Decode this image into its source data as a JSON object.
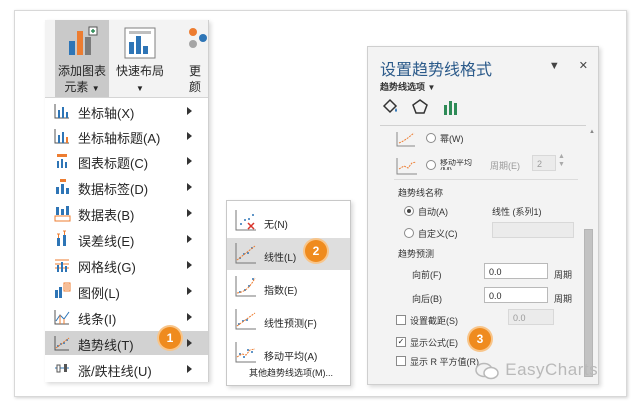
{
  "ribbon": {
    "add_element_line1": "添加图表",
    "add_element_line2": "元素",
    "quick_layout": "快速布局",
    "change_partial1": "更",
    "change_partial2": "颜"
  },
  "menu": {
    "items": [
      {
        "label": "坐标轴(X)"
      },
      {
        "label": "坐标轴标题(A)"
      },
      {
        "label": "图表标题(C)"
      },
      {
        "label": "数据标签(D)"
      },
      {
        "label": "数据表(B)"
      },
      {
        "label": "误差线(E)"
      },
      {
        "label": "网格线(G)"
      },
      {
        "label": "图例(L)"
      },
      {
        "label": "线条(I)"
      },
      {
        "label": "趋势线(T)"
      },
      {
        "label": "涨/跌柱线(U)"
      }
    ]
  },
  "submenu": {
    "items": [
      {
        "label": "无(N)"
      },
      {
        "label": "线性(L)"
      },
      {
        "label": "指数(E)"
      },
      {
        "label": "线性预测(F)"
      },
      {
        "label": "移动平均(A)"
      }
    ],
    "more": "其他趋势线选项(M)..."
  },
  "pane": {
    "title": "设置趋势线格式",
    "subtitle": "趋势线选项",
    "power": "幂(W)",
    "moving_avg": "移动平均(M)",
    "period_label": "周期(E)",
    "period_value": "2",
    "name_header": "趋势线名称",
    "auto": "自动(A)",
    "auto_value": "线性 (系列1)",
    "custom": "自定义(C)",
    "forecast_header": "趋势预测",
    "forward": "向前(F)",
    "forward_value": "0.0",
    "backward": "向后(B)",
    "backward_value": "0.0",
    "period_unit": "周期",
    "intercept": "设置截距(S)",
    "intercept_value": "0.0",
    "show_equation": "显示公式(E)",
    "show_r2": "显示 R 平方值(R)"
  },
  "badges": {
    "b1": "1",
    "b2": "2",
    "b3": "3"
  },
  "watermark": "EasyCharts",
  "colors": {
    "accent": "#ef8b1e",
    "title_blue": "#2b5a8a",
    "chart_blue": "#2e75b6",
    "chart_orange": "#ed7d31",
    "chart_green": "#2e8b57"
  }
}
